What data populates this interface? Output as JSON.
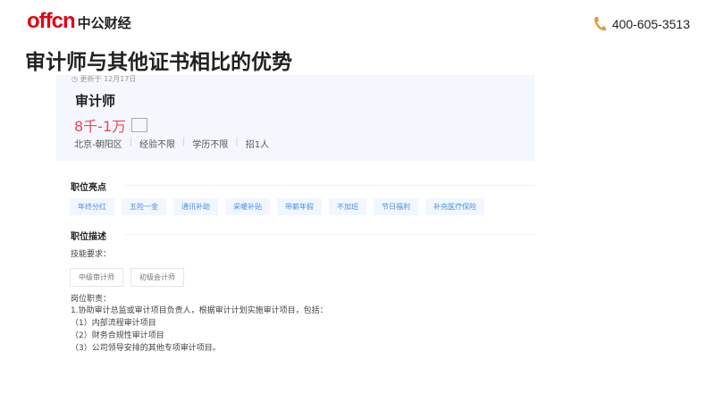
{
  "header": {
    "logo_en": "offcn",
    "logo_cn": "中公财经",
    "phone": "400-605-3513",
    "title": "审计师与其他证书相比的优势"
  },
  "job": {
    "updated": "更新于 12月17日",
    "name": "审计师",
    "salary": "8千-1万",
    "meta": [
      "北京-朝阳区",
      "经验不限",
      "学历不限",
      "招1人"
    ]
  },
  "highlights": {
    "heading": "职位亮点",
    "tags": [
      "年终分红",
      "五险一金",
      "通讯补助",
      "采暖补贴",
      "带薪年假",
      "不加班",
      "节日福利",
      "补充医疗保险"
    ]
  },
  "description": {
    "heading": "职位描述",
    "skills_label": "技能要求：",
    "skills": [
      "中级审计师",
      "初级会计师"
    ],
    "duty_label": "岗位职责：",
    "lines": [
      "1.协助审计总监或审计项目负责人，根据审计计划实施审计项目，包括：",
      "（1）内部流程审计项目",
      "（2）财务合规性审计项目",
      "（3）公司领导安排的其他专项审计项目。"
    ]
  }
}
